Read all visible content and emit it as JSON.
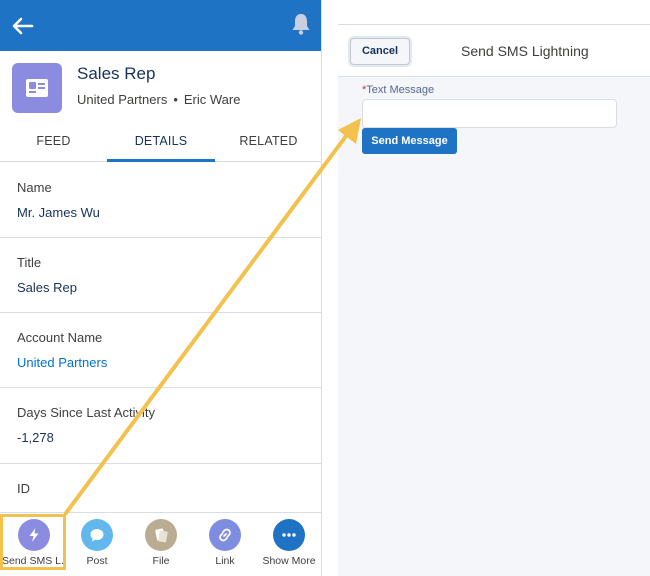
{
  "record": {
    "title": "Sales Rep",
    "account": "United Partners",
    "separator": "•",
    "owner": "Eric Ware"
  },
  "tabs": [
    {
      "label": "FEED"
    },
    {
      "label": "DETAILS"
    },
    {
      "label": "RELATED"
    }
  ],
  "fields": [
    {
      "label": "Name",
      "value": "Mr. James Wu"
    },
    {
      "label": "Title",
      "value": "Sales Rep"
    },
    {
      "label": "Account Name",
      "value": "United Partners"
    },
    {
      "label": "Days Since Last Activity",
      "value": "-1,278"
    },
    {
      "label": "ID",
      "value": ""
    }
  ],
  "actions": [
    {
      "label": "Send SMS L...",
      "icon": "lightning-icon",
      "color": "#8b8ce0"
    },
    {
      "label": "Post",
      "icon": "chat-bubble-icon",
      "color": "#62b7ed"
    },
    {
      "label": "File",
      "icon": "file-icon",
      "color": "#baac93"
    },
    {
      "label": "Link",
      "icon": "link-icon",
      "color": "#7f8de1"
    },
    {
      "label": "Show More",
      "icon": "more-icon",
      "color": "#1f73c4"
    }
  ],
  "sms": {
    "cancel_label": "Cancel",
    "title": "Send SMS Lightning",
    "required_mark": "*",
    "text_label": "Text Message",
    "text_value": "",
    "send_label": "Send Message"
  },
  "colors": {
    "brand": "#1f73c4",
    "highlight": "#f2c14e",
    "avatar": "#8b8ce0"
  }
}
